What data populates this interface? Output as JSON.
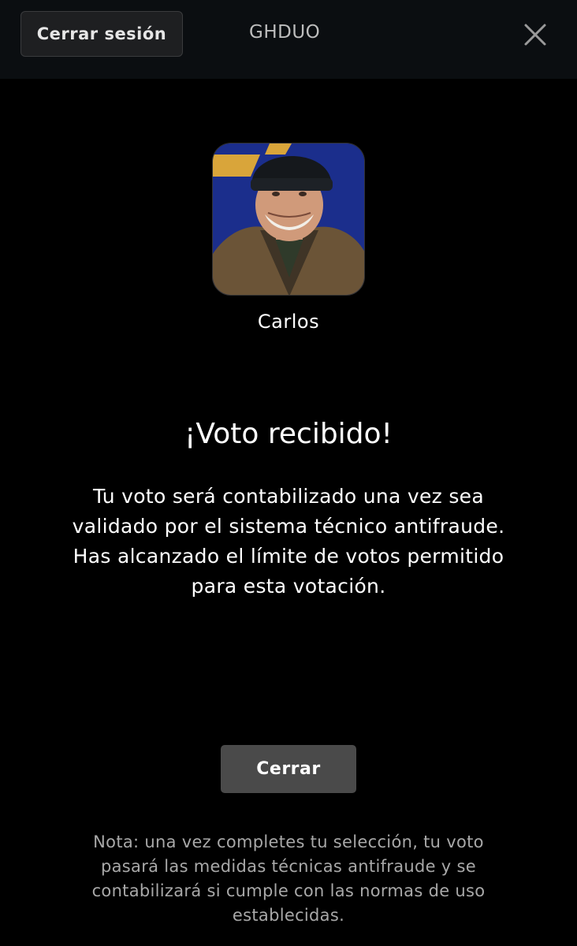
{
  "header": {
    "logout_label": "Cerrar sesión",
    "brand": "GHDUO",
    "close_icon": "close-icon"
  },
  "candidate": {
    "name": "Carlos",
    "photo": "candidate-photo"
  },
  "confirmation": {
    "title": "¡Voto recibido!",
    "message": "Tu voto será contabilizado una vez sea validado por el sistema técnico antifraude. Has alcanzado el límite de votos permitido para esta votación."
  },
  "actions": {
    "close_label": "Cerrar"
  },
  "footer": {
    "note": "Nota: una vez completes tu selección, tu voto pasará las medidas técnicas antifraude y se contabilizará si cumple con las normas de uso establecidas."
  },
  "colors": {
    "background": "#000000",
    "header_bg": "#0b0e11",
    "button_bg": "#4a4a4a",
    "note_text": "#a8a8a8"
  }
}
